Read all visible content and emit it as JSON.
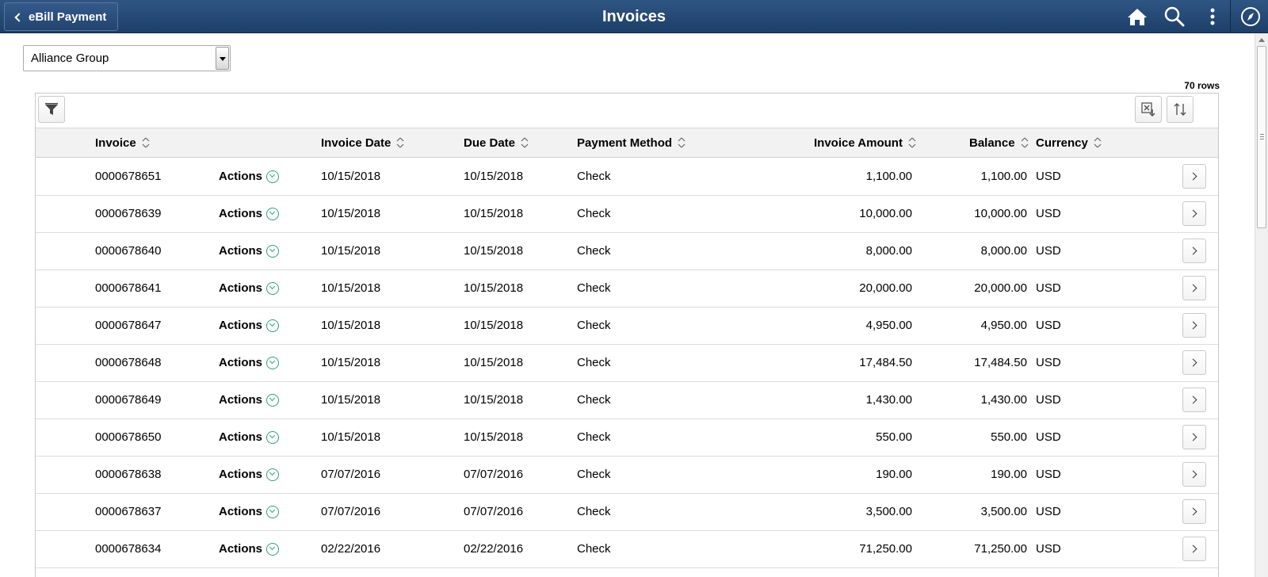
{
  "header": {
    "back_label": "eBill Payment",
    "title": "Invoices",
    "icons": [
      "home-icon",
      "search-icon",
      "more-options-icon",
      "navbar-compass-icon"
    ]
  },
  "customer_select": {
    "value": "Alliance Group"
  },
  "row_count": "70 rows",
  "columns": {
    "invoice": "Invoice",
    "invoice_date": "Invoice Date",
    "due_date": "Due Date",
    "payment_method": "Payment Method",
    "invoice_amount": "Invoice Amount",
    "balance": "Balance",
    "currency": "Currency"
  },
  "actions_label": "Actions",
  "rows": [
    {
      "invoice": "0000678651",
      "invoice_date": "10/15/2018",
      "due_date": "10/15/2018",
      "payment_method": "Check",
      "invoice_amount": "1,100.00",
      "balance": "1,100.00",
      "currency": "USD"
    },
    {
      "invoice": "0000678639",
      "invoice_date": "10/15/2018",
      "due_date": "10/15/2018",
      "payment_method": "Check",
      "invoice_amount": "10,000.00",
      "balance": "10,000.00",
      "currency": "USD"
    },
    {
      "invoice": "0000678640",
      "invoice_date": "10/15/2018",
      "due_date": "10/15/2018",
      "payment_method": "Check",
      "invoice_amount": "8,000.00",
      "balance": "8,000.00",
      "currency": "USD"
    },
    {
      "invoice": "0000678641",
      "invoice_date": "10/15/2018",
      "due_date": "10/15/2018",
      "payment_method": "Check",
      "invoice_amount": "20,000.00",
      "balance": "20,000.00",
      "currency": "USD"
    },
    {
      "invoice": "0000678647",
      "invoice_date": "10/15/2018",
      "due_date": "10/15/2018",
      "payment_method": "Check",
      "invoice_amount": "4,950.00",
      "balance": "4,950.00",
      "currency": "USD"
    },
    {
      "invoice": "0000678648",
      "invoice_date": "10/15/2018",
      "due_date": "10/15/2018",
      "payment_method": "Check",
      "invoice_amount": "17,484.50",
      "balance": "17,484.50",
      "currency": "USD"
    },
    {
      "invoice": "0000678649",
      "invoice_date": "10/15/2018",
      "due_date": "10/15/2018",
      "payment_method": "Check",
      "invoice_amount": "1,430.00",
      "balance": "1,430.00",
      "currency": "USD"
    },
    {
      "invoice": "0000678650",
      "invoice_date": "10/15/2018",
      "due_date": "10/15/2018",
      "payment_method": "Check",
      "invoice_amount": "550.00",
      "balance": "550.00",
      "currency": "USD"
    },
    {
      "invoice": "0000678638",
      "invoice_date": "07/07/2016",
      "due_date": "07/07/2016",
      "payment_method": "Check",
      "invoice_amount": "190.00",
      "balance": "190.00",
      "currency": "USD"
    },
    {
      "invoice": "0000678637",
      "invoice_date": "07/07/2016",
      "due_date": "07/07/2016",
      "payment_method": "Check",
      "invoice_amount": "3,500.00",
      "balance": "3,500.00",
      "currency": "USD"
    },
    {
      "invoice": "0000678634",
      "invoice_date": "02/22/2016",
      "due_date": "02/22/2016",
      "payment_method": "Check",
      "invoice_amount": "71,250.00",
      "balance": "71,250.00",
      "currency": "USD"
    }
  ],
  "colors": {
    "header_bg": "#2f5583",
    "action_accent": "#2aa37a"
  }
}
